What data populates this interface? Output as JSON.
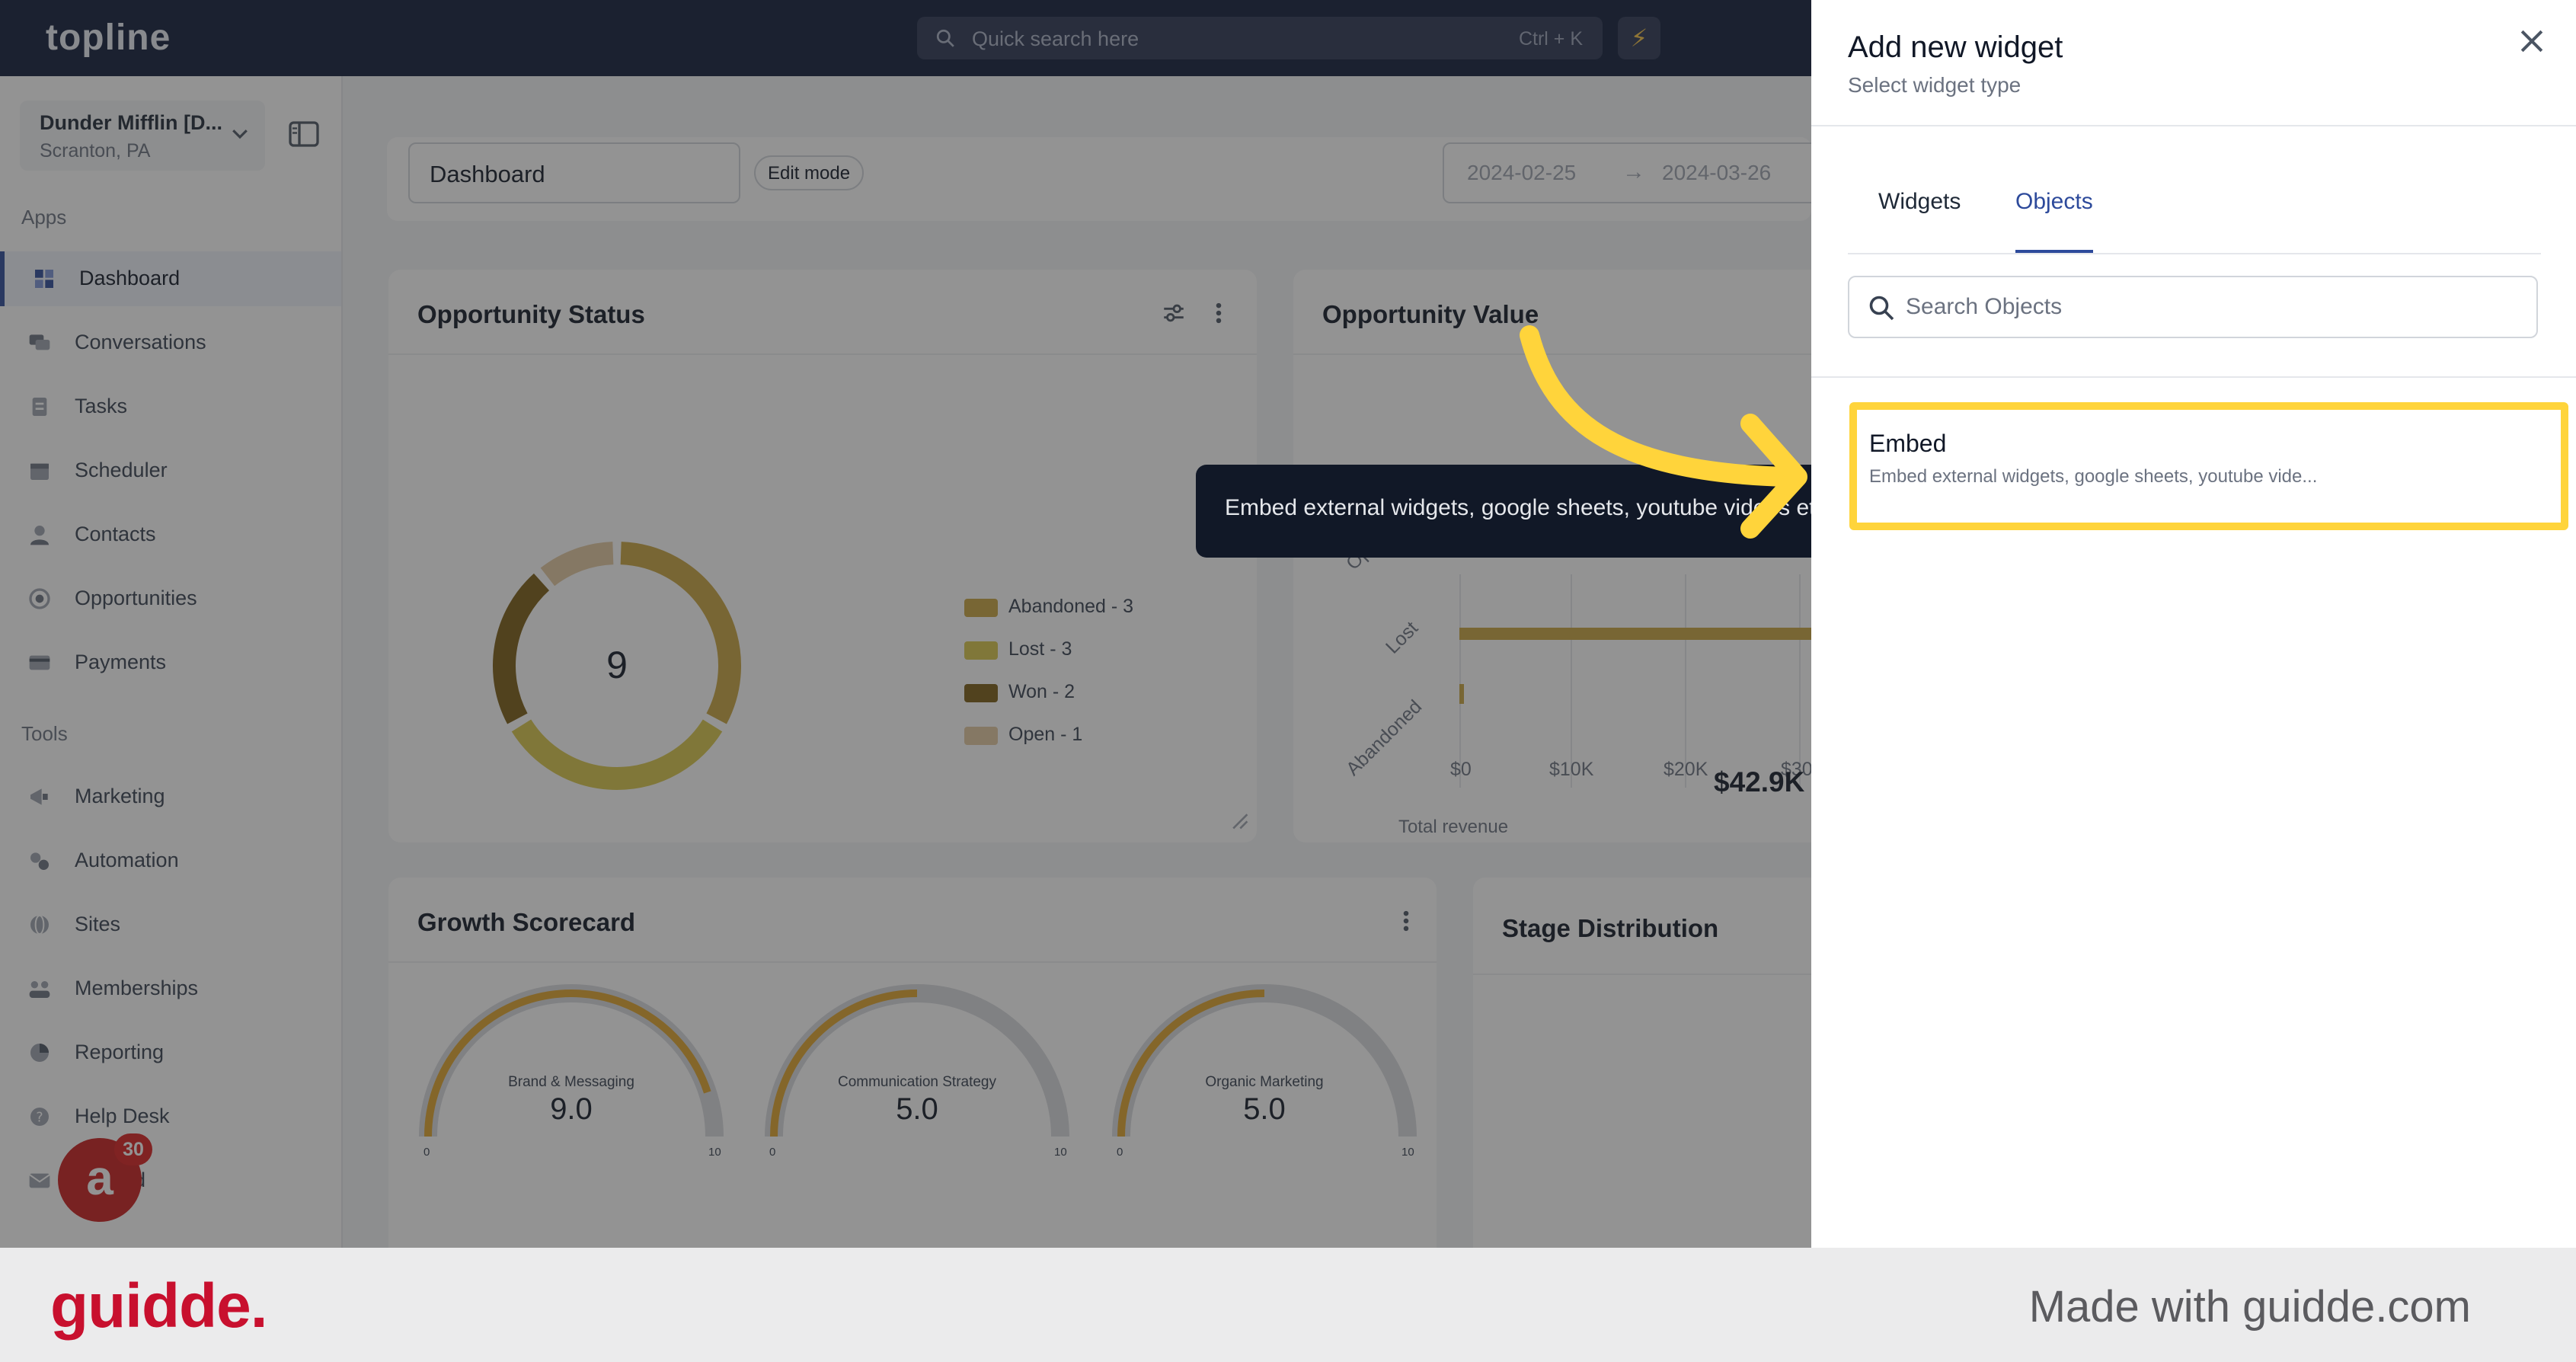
{
  "topbar": {
    "logo": "topline",
    "search_placeholder": "Quick search here",
    "search_shortcut": "Ctrl + K",
    "bolt_icon": "lightning-icon"
  },
  "sidebar": {
    "account_name": "Dunder Mifflin [D...",
    "account_location": "Scranton, PA",
    "apps_label": "Apps",
    "tools_label": "Tools",
    "apps": [
      {
        "label": "Dashboard",
        "icon": "dashboard-icon",
        "active": true
      },
      {
        "label": "Conversations",
        "icon": "chat-icon"
      },
      {
        "label": "Tasks",
        "icon": "clipboard-icon"
      },
      {
        "label": "Scheduler",
        "icon": "calendar-icon"
      },
      {
        "label": "Contacts",
        "icon": "person-icon"
      },
      {
        "label": "Opportunities",
        "icon": "target-icon"
      },
      {
        "label": "Payments",
        "icon": "card-icon"
      }
    ],
    "tools": [
      {
        "label": "Marketing",
        "icon": "megaphone-icon"
      },
      {
        "label": "Automation",
        "icon": "gears-icon"
      },
      {
        "label": "Sites",
        "icon": "globe-icon"
      },
      {
        "label": "Memberships",
        "icon": "people-icon"
      },
      {
        "label": "Reporting",
        "icon": "pie-icon"
      },
      {
        "label": "Help Desk",
        "icon": "help-icon"
      },
      {
        "label": "Mailfold",
        "icon": "mail-icon"
      }
    ],
    "notification_count": "30"
  },
  "controls": {
    "dashboard_name": "Dashboard",
    "edit_mode": "Edit mode",
    "date_from": "2024-02-25",
    "date_arrow": "→",
    "date_to": "2024-03-26"
  },
  "opportunity_status": {
    "title": "Opportunity Status",
    "total": "9",
    "legend": [
      {
        "label": "Abandoned - 3",
        "value": 3,
        "color": "#c8a441"
      },
      {
        "label": "Lost - 3",
        "value": 3,
        "color": "#d8c64a"
      },
      {
        "label": "Won - 2",
        "value": 2,
        "color": "#7a5c14"
      },
      {
        "label": "Open - 1",
        "value": 1,
        "color": "#e2c8a0"
      }
    ]
  },
  "opportunity_value": {
    "title": "Opportunity Value",
    "y_labels": [
      "Open",
      "Lost",
      "Abandoned"
    ],
    "x_ticks": [
      "$0",
      "$10K",
      "$20K",
      "$30"
    ],
    "total_label": "Total revenue",
    "total_value": "$42.9K"
  },
  "growth_scorecard": {
    "title": "Growth Scorecard",
    "gauges": [
      {
        "name": "Brand & Messaging",
        "value": 9.0,
        "display": "9.0",
        "min": "0",
        "max": "10"
      },
      {
        "name": "Communication Strategy",
        "value": 5.0,
        "display": "5.0",
        "min": "0",
        "max": "10"
      },
      {
        "name": "Organic Marketing",
        "value": 5.0,
        "display": "5.0",
        "min": "0",
        "max": "10"
      }
    ]
  },
  "stage_distribution": {
    "title": "Stage Distribution"
  },
  "tooltip": {
    "text": "Embed external widgets, google sheets, youtube videos etc"
  },
  "drawer": {
    "title": "Add new widget",
    "subtitle": "Select widget type",
    "tabs": [
      "Widgets",
      "Objects"
    ],
    "active_tab": "Objects",
    "search_placeholder": "Search Objects",
    "items": [
      {
        "title": "Embed",
        "description": "Embed external widgets, google sheets, youtube vide..."
      }
    ]
  },
  "footer": {
    "logo": "guidde.",
    "made_with": "Made with guidde.com"
  },
  "colors": {
    "topbar": "#0f1b38",
    "accent": "#2d4a9b",
    "highlight": "#ffd43b",
    "brand_red": "#c8102e"
  }
}
